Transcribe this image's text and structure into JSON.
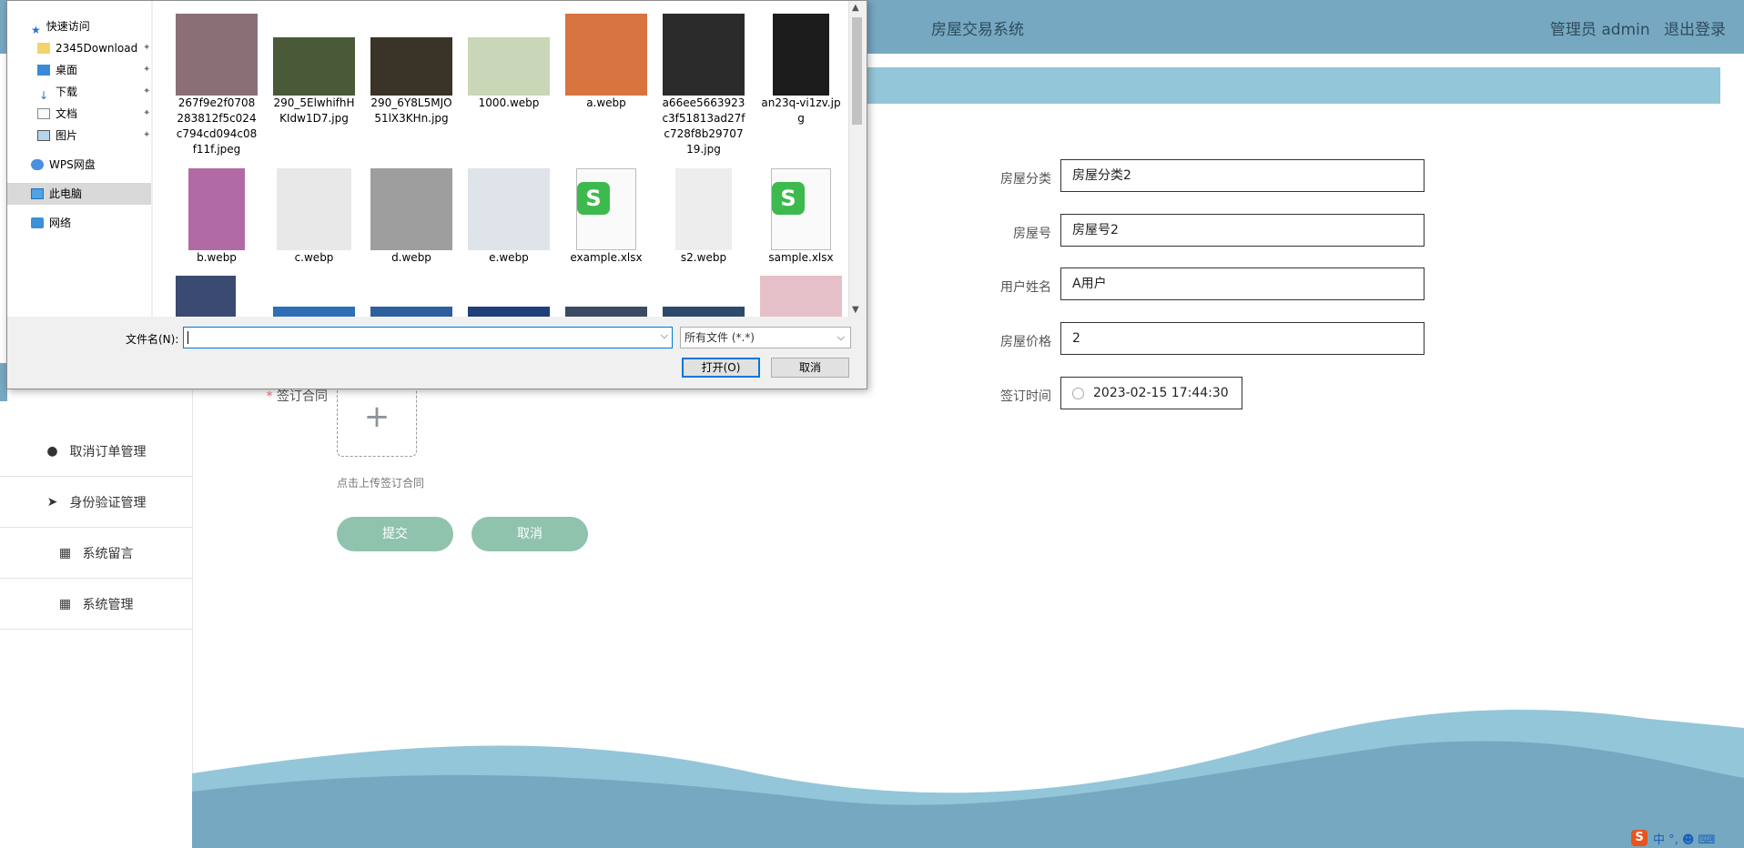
{
  "header": {
    "title": "房屋交易系统",
    "user": "管理员 admin",
    "logout": "退出登录"
  },
  "sidebar": {
    "items": [
      {
        "label": "取消订单管理",
        "icon": "bulb-icon"
      },
      {
        "label": "身份验证管理",
        "icon": "paper-plane-icon"
      },
      {
        "label": "系统留言",
        "icon": "grid-icon"
      },
      {
        "label": "系统管理",
        "icon": "grid-icon"
      }
    ]
  },
  "form": {
    "fields": [
      {
        "label": "房屋分类",
        "value": "房屋分类2"
      },
      {
        "label": "房屋号",
        "value": "房屋号2"
      },
      {
        "label": "用户姓名",
        "value": "A用户"
      },
      {
        "label": "房屋价格",
        "value": "2"
      },
      {
        "label": "签订时间",
        "value": "2023-02-15 17:44:30"
      }
    ],
    "contract_label": "签订合同",
    "required_mark": "*",
    "upload_tip": "点击上传签订合同",
    "submit": "提交",
    "cancel": "取消"
  },
  "dialog": {
    "nav": {
      "quick_access": "快速访问",
      "items": [
        "2345Download",
        "桌面",
        "下载",
        "文档",
        "图片"
      ],
      "wps": "WPS网盘",
      "this_pc": "此电脑",
      "network": "网络"
    },
    "files": [
      {
        "name": "267f9e2f0708283812f5c024c794cd094c08f11f.jpeg",
        "kind": "photo",
        "color": "#8a6f77"
      },
      {
        "name": "290_5ElwhifhHKIdw1D7.jpg",
        "kind": "photo",
        "color": "#4a5a38"
      },
      {
        "name": "290_6Y8L5MJO51lX3KHn.jpg",
        "kind": "photo",
        "color": "#3a3328"
      },
      {
        "name": "1000.webp",
        "kind": "photo",
        "color": "#c9d6b7"
      },
      {
        "name": "a.webp",
        "kind": "photo",
        "color": "#d7743f"
      },
      {
        "name": "a66ee5663923c3f51813ad27fc728f8b2970719.jpg",
        "kind": "photo",
        "color": "#2b2b2b"
      },
      {
        "name": "an23q-vi1zv.jpg",
        "kind": "photo",
        "color": "#1c1c1c"
      },
      {
        "name": "b.webp",
        "kind": "photo",
        "color": "#b26aa4"
      },
      {
        "name": "c.webp",
        "kind": "photo",
        "color": "#e8e8e8"
      },
      {
        "name": "d.webp",
        "kind": "photo",
        "color": "#9e9e9e"
      },
      {
        "name": "e.webp",
        "kind": "photo",
        "color": "#dfe3ea"
      },
      {
        "name": "example.xlsx",
        "kind": "sheet",
        "color": "#3dba4e"
      },
      {
        "name": "s2.webp",
        "kind": "photo",
        "color": "#ededed"
      },
      {
        "name": "sample.xlsx",
        "kind": "sheet",
        "color": "#3dba4e"
      }
    ],
    "partial_row_colors": [
      "#3a4a70",
      "#2f6fb5",
      "#2d5f9e",
      "#1e3f7a",
      "#3a4b63",
      "#2d4a6b",
      "#e6c0c8"
    ],
    "filename_label": "文件名(N):",
    "filename_value": "",
    "filter": "所有文件 (*.*)",
    "open": "打开(O)",
    "cancel": "取消"
  },
  "ime": {
    "logo": "S",
    "text": "中 °, ☻ ⌨"
  }
}
